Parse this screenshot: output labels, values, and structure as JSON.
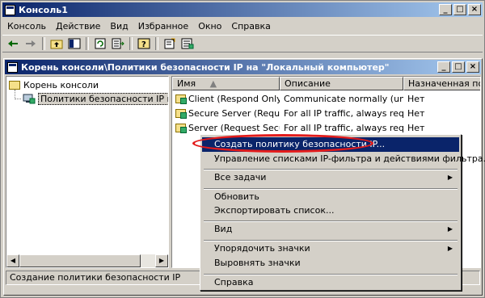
{
  "app": {
    "title": "Консоль1",
    "window_buttons": [
      "_",
      "□",
      "×"
    ]
  },
  "menubar": {
    "items": [
      "Консоль",
      "Действие",
      "Вид",
      "Избранное",
      "Окно",
      "Справка"
    ]
  },
  "toolbar": {
    "icons": [
      "back-arrow-icon",
      "forward-arrow-icon",
      "up-folder-icon",
      "show-hide-tree-icon",
      "refresh-icon",
      "export-list-icon",
      "help-icon",
      "create-policy-icon",
      "manage-filters-icon"
    ]
  },
  "child_window": {
    "title": "Корень консоли\\Политики безопасности IP на \"Локальный компьютер\""
  },
  "tree": {
    "root": "Корень консоли",
    "child": "Политики безопасности IP на \"Ло"
  },
  "list": {
    "columns": [
      "Имя",
      "Описание",
      "Назначенная поли"
    ],
    "rows": [
      {
        "name": "Client (Respond Only)",
        "description": "Communicate normally (uns...",
        "assigned": "Нет"
      },
      {
        "name": "Secure Server (Requir...",
        "description": "For all IP traffic, always req...",
        "assigned": "Нет"
      },
      {
        "name": "Server (Request Secu...",
        "description": "For all IP traffic, always req...",
        "assigned": "Нет"
      }
    ]
  },
  "context_menu": {
    "items": [
      {
        "label": "Создать политику безопасности IP...",
        "highlighted": true,
        "submenu": false
      },
      {
        "label": "Управление списками IP-фильтра и действиями фильтра...",
        "highlighted": false,
        "submenu": false
      },
      {
        "label": "Все задачи",
        "highlighted": false,
        "submenu": true
      },
      {
        "label": "Обновить",
        "highlighted": false,
        "submenu": false
      },
      {
        "label": "Экспортировать список...",
        "highlighted": false,
        "submenu": false
      },
      {
        "label": "Вид",
        "highlighted": false,
        "submenu": true
      },
      {
        "label": "Упорядочить значки",
        "highlighted": false,
        "submenu": true
      },
      {
        "label": "Выровнять значки",
        "highlighted": false,
        "submenu": false
      },
      {
        "label": "Справка",
        "highlighted": false,
        "submenu": false
      }
    ]
  },
  "status": {
    "text": "Создание политики безопасности IP"
  },
  "colors": {
    "title_start": "#0a246a",
    "title_end": "#a6caf0",
    "face": "#d4d0c8",
    "highlight": "#0a246a",
    "callout": "#e31b1b"
  }
}
